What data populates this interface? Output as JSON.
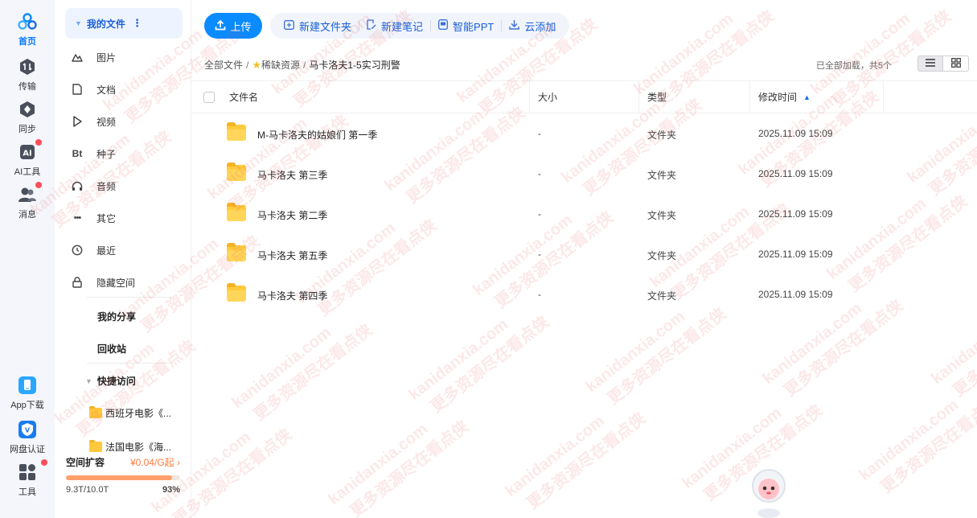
{
  "rail": {
    "items": [
      {
        "label": "首页",
        "icon": "cloud-logo-icon"
      },
      {
        "label": "传输",
        "icon": "transfer-icon"
      },
      {
        "label": "同步",
        "icon": "sync-icon"
      },
      {
        "label": "AI工具",
        "icon": "ai-icon"
      },
      {
        "label": "消息",
        "icon": "message-icon"
      },
      {
        "label": "App下载",
        "icon": "phone-icon"
      },
      {
        "label": "网盘认证",
        "icon": "verify-icon"
      },
      {
        "label": "工具",
        "icon": "tools-icon"
      }
    ]
  },
  "sidebar": {
    "my_files": "我的文件",
    "items": [
      {
        "label": "图片",
        "glyph": "⛰"
      },
      {
        "label": "文档",
        "glyph": "▯"
      },
      {
        "label": "视频",
        "glyph": "▷"
      },
      {
        "label": "种子",
        "glyph": "Bt"
      },
      {
        "label": "音频",
        "glyph": "🎧"
      },
      {
        "label": "其它",
        "glyph": "•••"
      },
      {
        "label": "最近",
        "glyph": "◷"
      },
      {
        "label": "隐藏空间",
        "glyph": "🔒"
      }
    ],
    "my_share": "我的分享",
    "recycle": "回收站",
    "quick_access": "快捷访问",
    "quick_items": [
      "西班牙电影《...",
      "法国电影《海..."
    ],
    "expand": {
      "title": "空间扩容",
      "price": "¥0.04/G起",
      "used": "9.3T/10.0T",
      "percent_label": "93%",
      "percent": 93
    }
  },
  "toolbar": {
    "upload": "上传",
    "tools": [
      {
        "label": "新建文件夹",
        "glyph": "⊕"
      },
      {
        "label": "新建笔记",
        "glyph": "✎"
      },
      {
        "label": "智能PPT",
        "glyph": "▣"
      },
      {
        "label": "云添加",
        "glyph": "⤓"
      }
    ]
  },
  "breadcrumb": {
    "root": "全部文件",
    "parent": "稀缺资源",
    "current": "马卡洛夫1-5实习刑警"
  },
  "status": "已全部加载，共5个",
  "table": {
    "headers": {
      "name": "文件名",
      "size": "大小",
      "type": "类型",
      "modified": "修改时间"
    },
    "rows": [
      {
        "name": "M-马卡洛夫的姑娘们 第一季",
        "size": "-",
        "type": "文件夹",
        "modified": "2025.11.09 15:09"
      },
      {
        "name": "马卡洛夫 第三季",
        "size": "-",
        "type": "文件夹",
        "modified": "2025.11.09 15:09"
      },
      {
        "name": "马卡洛夫 第二季",
        "size": "-",
        "type": "文件夹",
        "modified": "2025.11.09 15:09"
      },
      {
        "name": "马卡洛夫 第五季",
        "size": "-",
        "type": "文件夹",
        "modified": "2025.11.09 15:09"
      },
      {
        "name": "马卡洛夫 第四季",
        "size": "-",
        "type": "文件夹",
        "modified": "2025.11.09 15:09"
      }
    ]
  },
  "watermark": {
    "line1": "kanidanxia.com",
    "line2": "更多资源尽在看点侠"
  },
  "colors": {
    "accent": "#0a8bff",
    "badge": "#ff4d5a",
    "folder": "#ffcb3d",
    "price": "#ff7a3d"
  }
}
